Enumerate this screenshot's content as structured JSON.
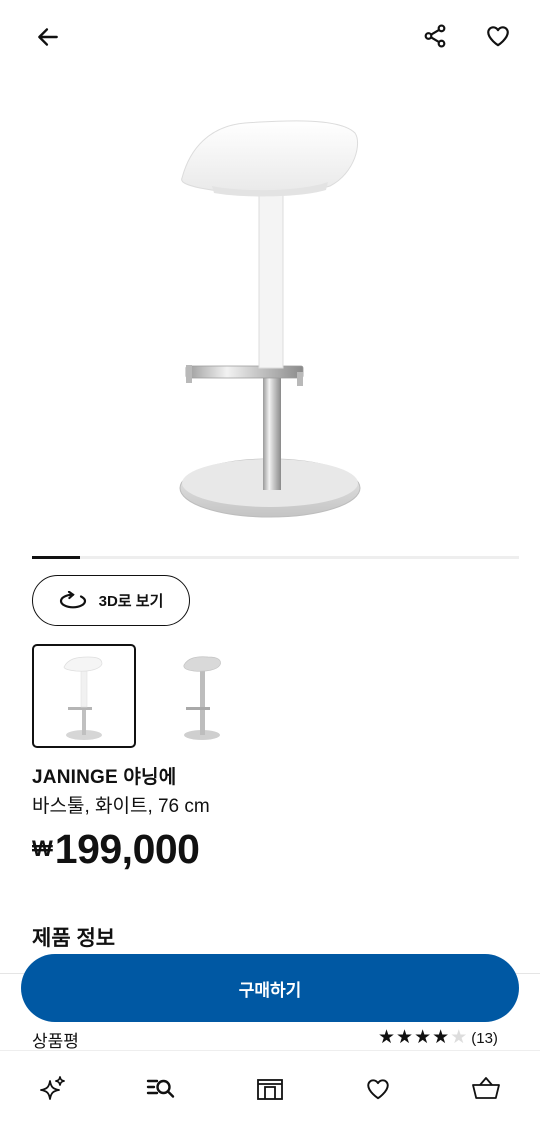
{
  "header": {
    "back_icon": "arrow-left-icon",
    "share_icon": "share-icon",
    "favorite_icon": "heart-icon"
  },
  "gallery": {
    "image_count_indicator_fraction": 0.1,
    "view_3d_label": "3D로 보기",
    "thumbnails": [
      {
        "name": "thumbnail-white",
        "selected": true
      },
      {
        "name": "thumbnail-silver",
        "selected": false
      }
    ]
  },
  "product": {
    "name": "JANINGE 야닝에",
    "description": "바스툴, 화이트, 76 cm",
    "currency": "₩",
    "price": "199,000"
  },
  "sections": {
    "product_info_title": "제품 정보",
    "reviews_label": "상품평",
    "rating": 4,
    "rating_max": 5,
    "review_count": "(13)"
  },
  "cta": {
    "buy_label": "구매하기"
  },
  "bottom_nav": [
    "sparkle-icon",
    "search-list-icon",
    "store-icon",
    "heart-icon",
    "basket-icon"
  ],
  "colors": {
    "primary_blue": "#0058a3",
    "text": "#111111"
  }
}
